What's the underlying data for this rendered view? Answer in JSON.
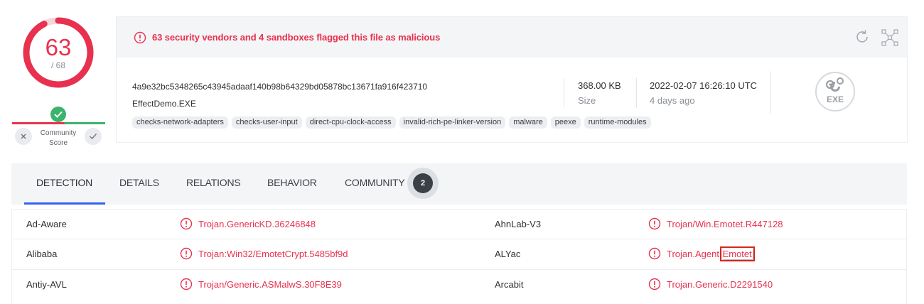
{
  "score": {
    "positives": "63",
    "total": "/ 68",
    "detection_ratio": 0.926,
    "accent_color": "#e8314f"
  },
  "community": {
    "label_line1": "Community",
    "label_line2": "Score",
    "status_icon": "check-icon",
    "down_icon": "close-icon",
    "up_icon": "check-icon"
  },
  "banner": {
    "icon": "alert-circle-icon",
    "message": "63 security vendors and 4 sandboxes flagged this file as malicious",
    "tools": [
      "reanalyze-icon",
      "graph-icon"
    ]
  },
  "file": {
    "sha256": "4a9e32bc5348265c43945adaaf140b98b64329bd05878bc13671fa916f423710",
    "name": "EffectDemo.EXE",
    "size_value": "368.00 KB",
    "size_label": "Size",
    "date_value": "2022-02-07 16:26:10 UTC",
    "date_ago": "4 days ago",
    "type_label": "EXE",
    "tags": [
      "checks-network-adapters",
      "checks-user-input",
      "direct-cpu-clock-access",
      "invalid-rich-pe-linker-version",
      "malware",
      "peexe",
      "runtime-modules"
    ]
  },
  "tabs": [
    {
      "label": "DETECTION",
      "active": true
    },
    {
      "label": "DETAILS"
    },
    {
      "label": "RELATIONS"
    },
    {
      "label": "BEHAVIOR"
    },
    {
      "label": "COMMUNITY",
      "badge": "2"
    }
  ],
  "detections": [
    {
      "vendor": "Ad-Aware",
      "result": "Trojan.GenericKD.36246848",
      "vendor2": "AhnLab-V3",
      "result2": "Trojan/Win.Emotet.R447128"
    },
    {
      "vendor": "Alibaba",
      "result": "Trojan:Win32/EmotetCrypt.5485bf9d",
      "vendor2": "ALYac",
      "result2_prefix": "Trojan.Agent.",
      "result2_highlight": "Emotet"
    },
    {
      "vendor": "Antiy-AVL",
      "result": "Trojan/Generic.ASMalwS.30F8E39",
      "vendor2": "Arcabit",
      "result2": "Trojan.Generic.D2291540"
    }
  ]
}
